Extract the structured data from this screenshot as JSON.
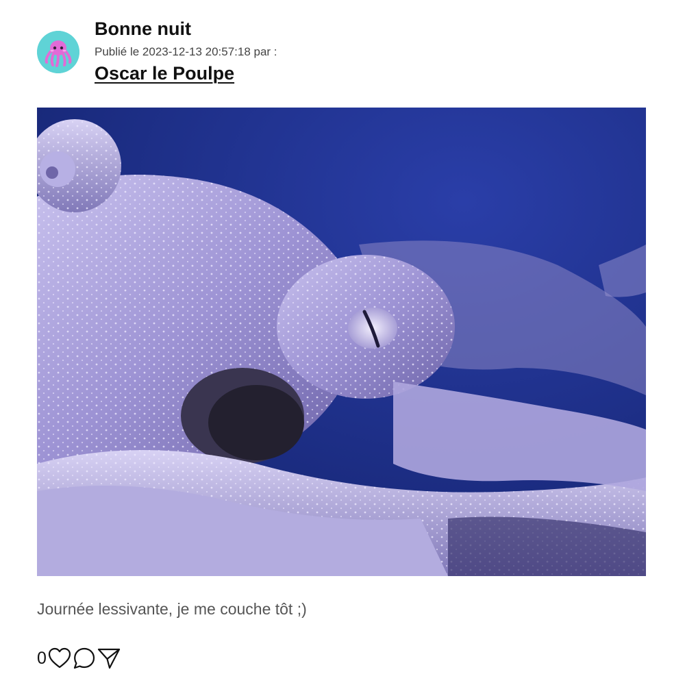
{
  "post": {
    "title": "Bonne nuit",
    "meta": "Publié le 2023-12-13 20:57:18 par :",
    "author": "Oscar le Poulpe",
    "caption": "Journée lessivante, je me couche tôt ;)",
    "like_count": "0"
  },
  "icons": {
    "avatar": "octopus-avatar-icon",
    "like": "heart-icon",
    "comment": "comment-bubble-icon",
    "share": "send-paper-plane-icon"
  },
  "colors": {
    "avatar_background": "#5fd3d6",
    "avatar_octopus": "#e26bd6",
    "image_background": "#1d2e86",
    "caption_text": "#555555"
  }
}
